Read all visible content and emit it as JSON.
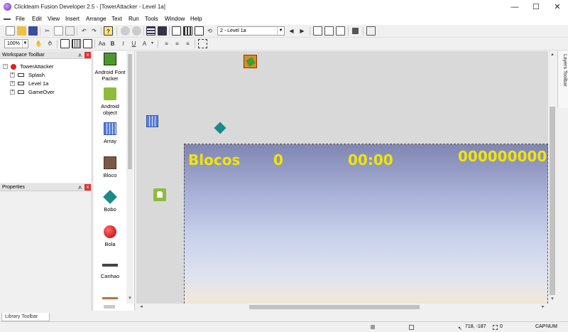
{
  "window": {
    "title": "Clickteam Fusion Developer 2.5 - [TowerAttacker - Level 1a]",
    "minimize": "—",
    "maximize": "☐",
    "close": "✕"
  },
  "menu": [
    "File",
    "Edit",
    "View",
    "Insert",
    "Arrange",
    "Text",
    "Run",
    "Tools",
    "Window",
    "Help"
  ],
  "toolbar": {
    "frame_selector": "2 - Level 1a",
    "zoom": "100%"
  },
  "workspace": {
    "title": "Workspace Toolbar",
    "pin": "ᗑ",
    "close": "x",
    "root": "TowerAttacker",
    "frames": [
      "Splash",
      "Level 1a",
      "GameOver"
    ]
  },
  "properties": {
    "title": "Properties"
  },
  "objects": [
    {
      "label": "Android Font Packer",
      "icon": "font-packer-icon"
    },
    {
      "label": "Android object",
      "icon": "android-icon"
    },
    {
      "label": "Array",
      "icon": "array-icon"
    },
    {
      "label": "Bloco",
      "icon": "bloco-icon"
    },
    {
      "label": "Bobo",
      "icon": "diamond-icon"
    },
    {
      "label": "Bola",
      "icon": "ball-icon"
    },
    {
      "label": "Canhao",
      "icon": "cannon-icon"
    }
  ],
  "hud": {
    "blocos_label": "Blocos",
    "blocos_value": "0",
    "timer": "00:00",
    "score": "000000000"
  },
  "layers_toolbar": "Layers Toolbar",
  "library_toolbar": "Library Toolbar",
  "status": {
    "coords": "718, -187",
    "selection": "0",
    "caps": "CAP",
    "num": "NUM"
  },
  "colors": {
    "hud_text": "#f2e40a",
    "editor_bg": "#d9d9d9"
  }
}
